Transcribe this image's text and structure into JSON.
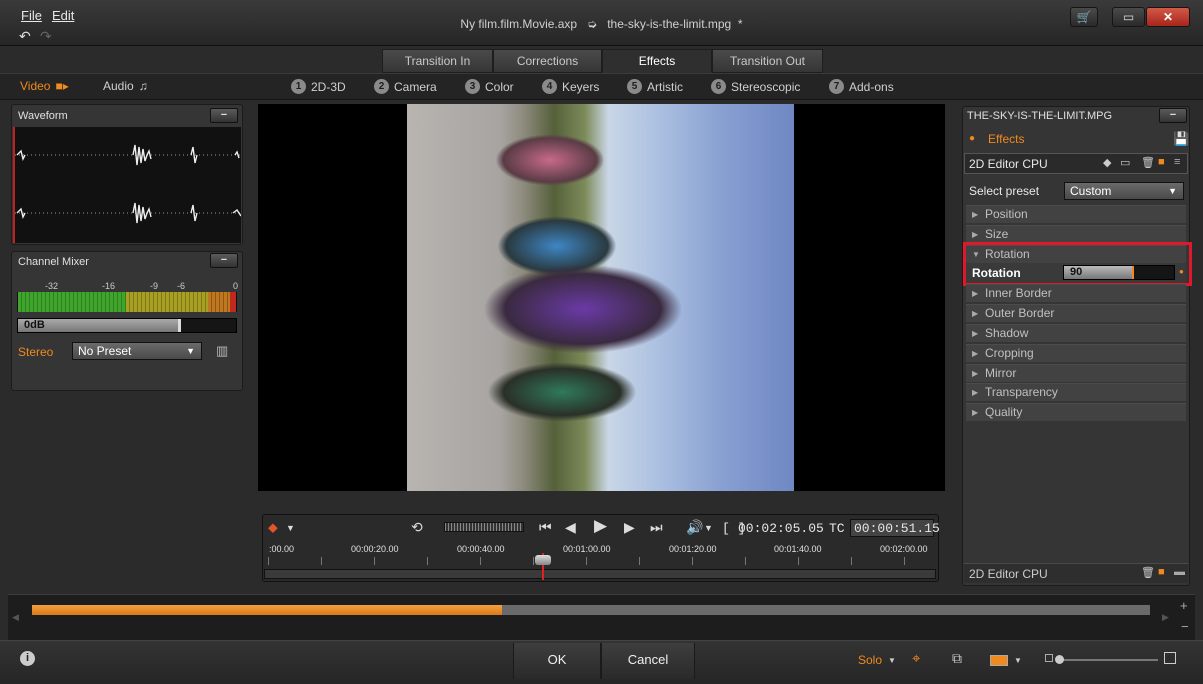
{
  "menu": {
    "file": "File",
    "edit": "Edit"
  },
  "window": {
    "project": "Ny film.film.Movie.axp",
    "arrow": "➭",
    "clip": "the-sky-is-the-limit.mpg",
    "modified": "*"
  },
  "tabs": [
    {
      "label": "Transition In"
    },
    {
      "label": "Corrections"
    },
    {
      "label": "Effects",
      "active": true
    },
    {
      "label": "Transition Out"
    }
  ],
  "media": {
    "video": "Video",
    "audio": "Audio"
  },
  "categories": [
    {
      "num": "1",
      "label": "2D-3D"
    },
    {
      "num": "2",
      "label": "Camera"
    },
    {
      "num": "3",
      "label": "Color"
    },
    {
      "num": "4",
      "label": "Keyers"
    },
    {
      "num": "5",
      "label": "Artistic"
    },
    {
      "num": "6",
      "label": "Stereoscopic"
    },
    {
      "num": "7",
      "label": "Add-ons"
    }
  ],
  "waveform": {
    "title": "Waveform",
    "min": "−"
  },
  "mixer": {
    "title": "Channel Mixer",
    "min": "−",
    "scale": [
      "-32",
      "-16",
      "-9",
      "-6",
      "0"
    ],
    "level": "0dB",
    "stereo": "Stereo",
    "preset": "No Preset"
  },
  "transport": {
    "duration_icon": "[ ]",
    "duration": "00:02:05.05",
    "tc_label": "TC",
    "timecode": "00:00:51.15",
    "ruler": [
      ":00.00",
      "00:00:20.00",
      "00:00:40.00",
      "00:01:00.00",
      "00:01:20.00",
      "00:01:40.00",
      "00:02:00.00"
    ]
  },
  "effects_panel": {
    "clip_name": "THE-SKY-IS-THE-LIMIT.MPG",
    "min": "−",
    "effects_label": "Effects",
    "editor": "2D Editor CPU",
    "select_preset_label": "Select preset",
    "preset_value": "Custom",
    "groups": [
      {
        "label": "Position",
        "expanded": false
      },
      {
        "label": "Size",
        "expanded": false
      },
      {
        "label": "Rotation",
        "expanded": true
      },
      {
        "label": "Inner Border",
        "expanded": false
      },
      {
        "label": "Outer Border",
        "expanded": false
      },
      {
        "label": "Shadow",
        "expanded": false
      },
      {
        "label": "Cropping",
        "expanded": false
      },
      {
        "label": "Mirror",
        "expanded": false
      },
      {
        "label": "Transparency",
        "expanded": false
      },
      {
        "label": "Quality",
        "expanded": false
      }
    ],
    "rotation_param": {
      "label": "Rotation",
      "value": "90",
      "fraction": 0.62
    },
    "footer_editor": "2D Editor CPU"
  },
  "timeline": {
    "progress_fraction": 0.42
  },
  "footer": {
    "ok": "OK",
    "cancel": "Cancel",
    "solo": "Solo"
  },
  "colors": {
    "accent": "#f08a1e",
    "highlight_box": "#e0182a"
  }
}
